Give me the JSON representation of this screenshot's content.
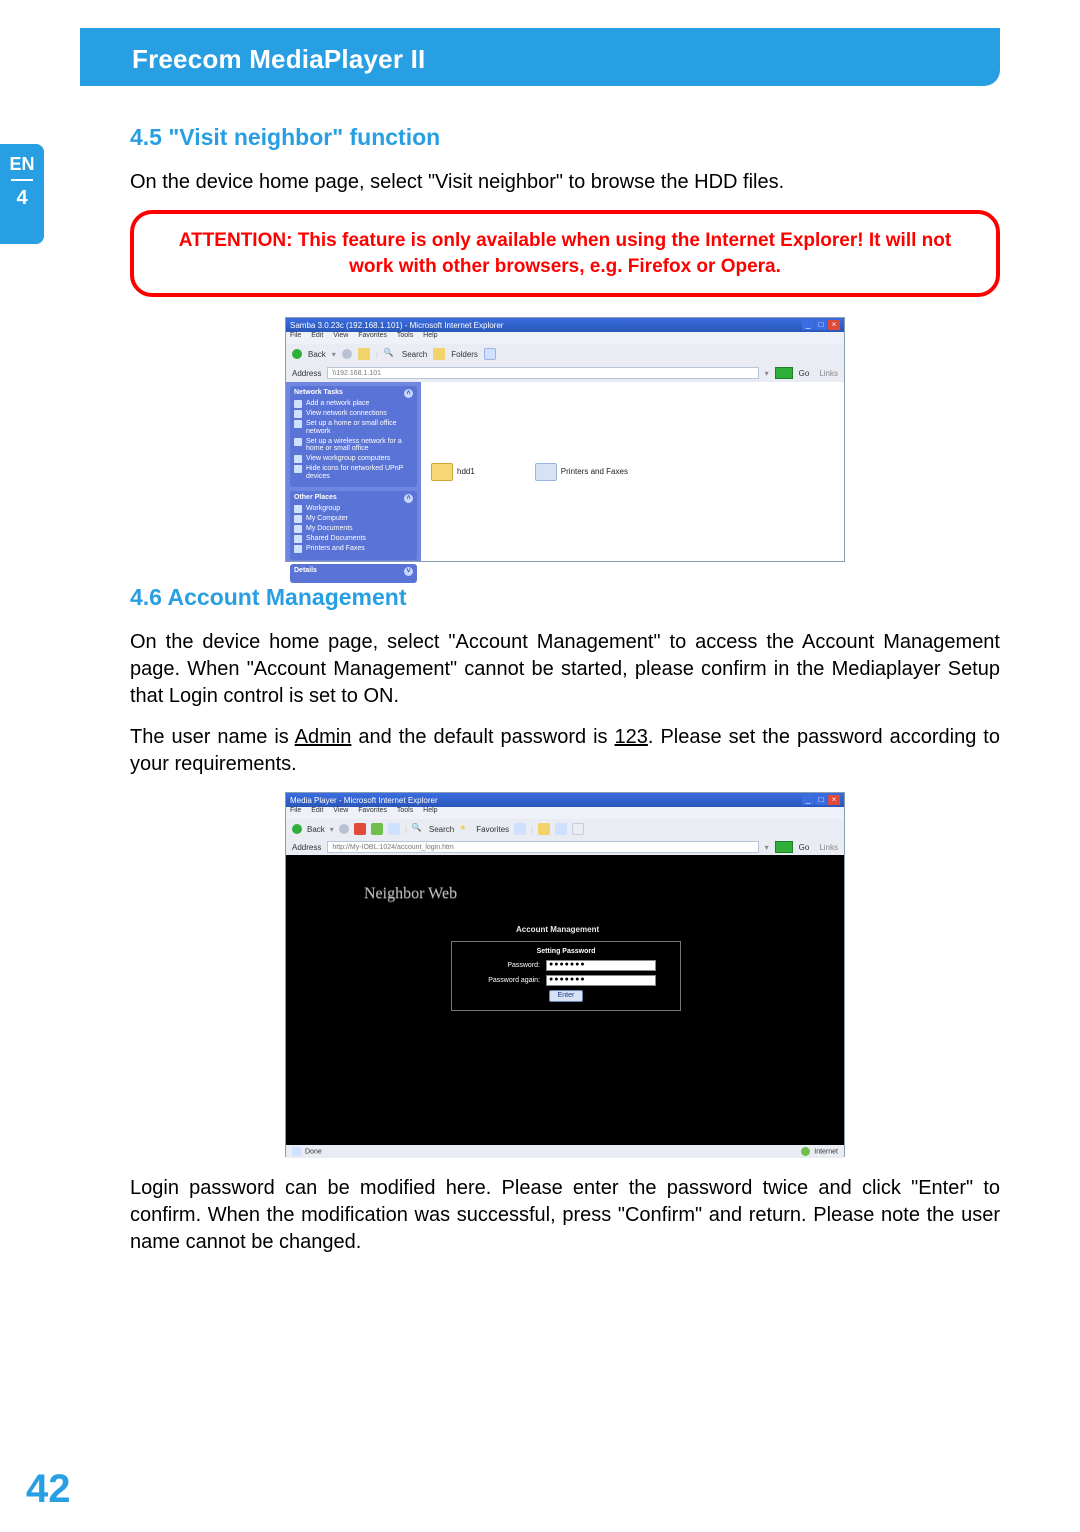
{
  "header": {
    "title": "Freecom MediaPlayer II"
  },
  "side_tab": {
    "lang": "EN",
    "chapter": "4"
  },
  "section_45": {
    "heading": "4.5 \"Visit neighbor\" function",
    "para1": "On the device home page, select \"Visit neighbor\" to browse the HDD files."
  },
  "attention": {
    "text": "ATTENTION: This feature is only available when using the Internet Explorer! It will not work with other browsers, e.g. Firefox or Opera."
  },
  "shot1": {
    "title": "Samba 3.0.23c (192.168.1.101) - Microsoft Internet Explorer",
    "menu": [
      "File",
      "Edit",
      "View",
      "Favorites",
      "Tools",
      "Help"
    ],
    "toolbar": {
      "back": "Back",
      "search": "Search",
      "folders": "Folders"
    },
    "address_label": "Address",
    "address_value": "\\\\192.168.1.101",
    "go": "Go",
    "links": "Links",
    "side": {
      "network_tasks": {
        "title": "Network Tasks",
        "items": [
          "Add a network place",
          "View network connections",
          "Set up a home or small office network",
          "Set up a wireless network for a home or small office",
          "View workgroup computers",
          "Hide icons for networked UPnP devices"
        ]
      },
      "other_places": {
        "title": "Other Places",
        "items": [
          "Workgroup",
          "My Computer",
          "My Documents",
          "Shared Documents",
          "Printers and Faxes"
        ]
      },
      "details": {
        "title": "Details"
      }
    },
    "content": {
      "folder1": "hdd1",
      "folder2": "Printers and Faxes"
    }
  },
  "section_46": {
    "heading": "4.6 Account Management",
    "para1": "On the device home page, select \"Account Management\" to access the Account Management page. When \"Account Management\" cannot be started, please confirm in the Mediaplayer Setup that Login control is set to ON.",
    "para2a": "The user name is ",
    "para2_admin": "Admin",
    "para2b": " and the default password is ",
    "para2_pw": "123",
    "para2c": ". Please set the password according to your requirements.",
    "para3": "Login password can be modified here. Please enter the password twice and click \"Enter\" to confirm. When the modification was successful, press \"Confirm\" and return. Please note the user name cannot be changed."
  },
  "shot2": {
    "title": "Media Player - Microsoft Internet Explorer",
    "menu": [
      "File",
      "Edit",
      "View",
      "Favorites",
      "Tools",
      "Help"
    ],
    "toolbar": {
      "back": "Back",
      "search": "Search",
      "favorites": "Favorites"
    },
    "address_label": "Address",
    "address_value": "http://My-IOBL:1024/account_login.htm",
    "go": "Go",
    "links": "Links",
    "logo": "Neighbor Web",
    "panel_title": "Account Management",
    "form_title": "Setting Password",
    "row1_label": "Password:",
    "row1_value": "●●●●●●●",
    "row2_label": "Password again:",
    "row2_value": "●●●●●●●",
    "button": "Enter",
    "status_left": "Done",
    "status_right": "Internet"
  },
  "page_number": "42"
}
